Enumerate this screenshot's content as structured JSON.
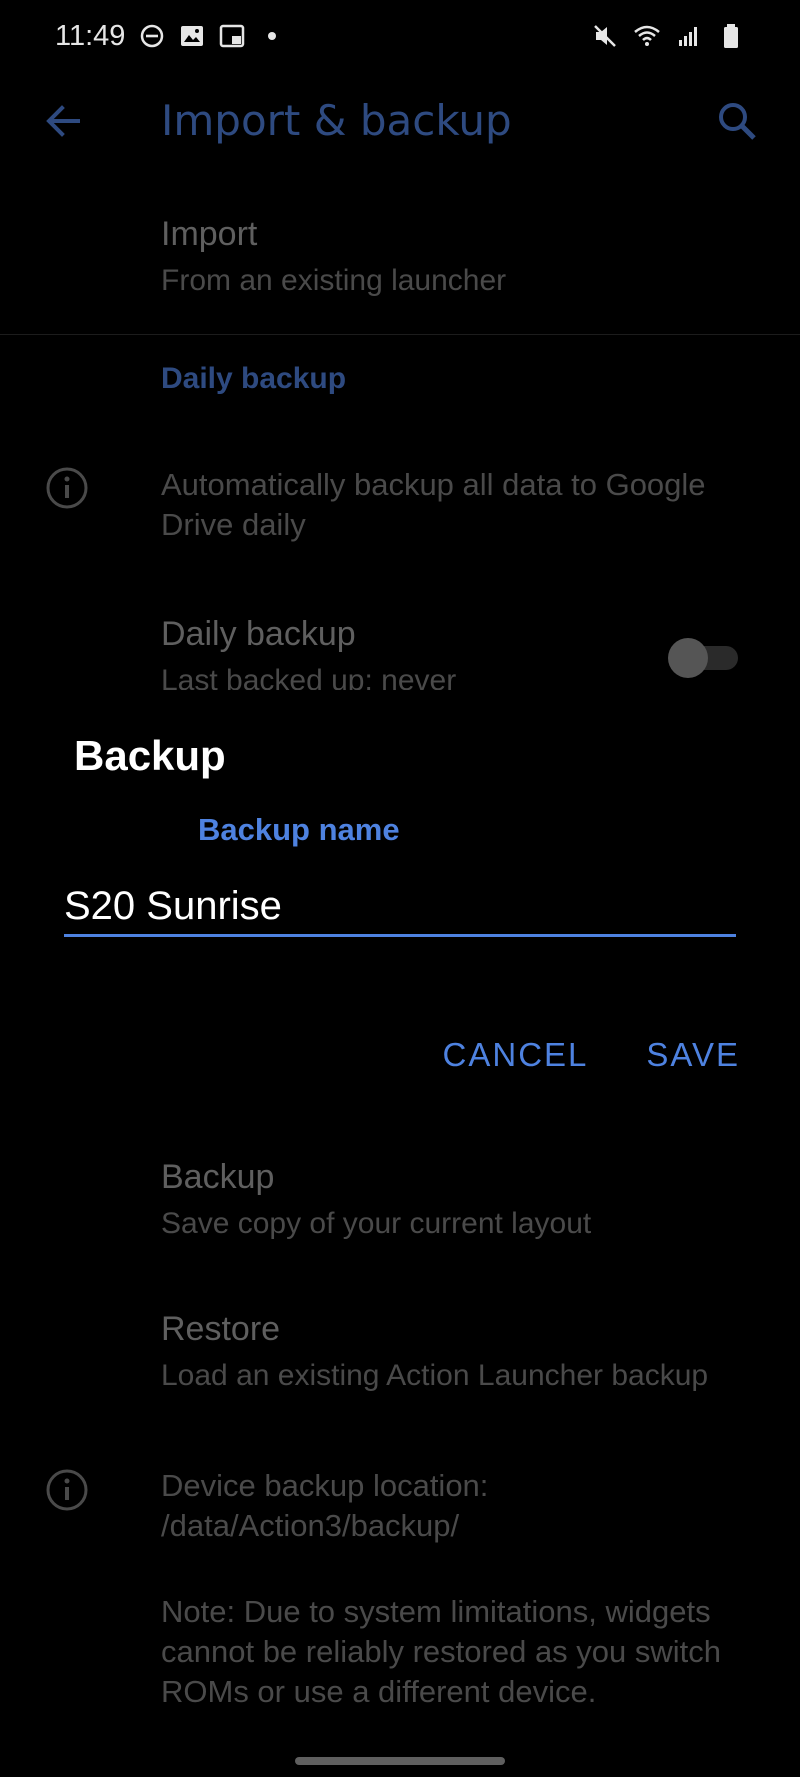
{
  "status_bar": {
    "time": "11:49",
    "left_icons": [
      "do-not-disturb-icon",
      "gallery-icon",
      "screenshot-icon",
      "dot-icon"
    ],
    "right_icons": [
      "mute-icon",
      "wifi-icon",
      "signal-icon",
      "battery-icon"
    ]
  },
  "app_bar": {
    "title": "Import & backup",
    "back_icon": "arrow-back-icon",
    "search_icon": "search-icon"
  },
  "import": {
    "title": "Import",
    "summary": "From an existing launcher"
  },
  "daily_backup_section": {
    "header": "Daily backup",
    "info": "Automatically backup all data to Google Drive daily",
    "pref_title": "Daily backup",
    "pref_summary": "Last backed up: never",
    "toggle_enabled": false
  },
  "dialog": {
    "title": "Backup",
    "field_label": "Backup name",
    "field_value": "S20 Sunrise",
    "cancel_label": "CANCEL",
    "save_label": "SAVE"
  },
  "backup": {
    "title": "Backup",
    "summary": "Save copy of your current layout"
  },
  "restore": {
    "title": "Restore",
    "summary": "Load an existing Action Launcher backup"
  },
  "location_info": "Device backup location: /data/Action3/backup/",
  "note_info": "Note: Due to system limitations, widgets cannot be reliably restored as you switch ROMs or use a different device.",
  "colors": {
    "accent": "#4e82e0",
    "accent_dim": "#2e4a80",
    "background": "#000000",
    "text_dim": "#5f5f5f"
  }
}
